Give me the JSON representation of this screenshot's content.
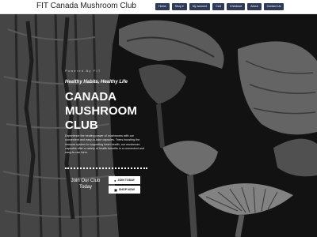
{
  "site": {
    "brand": "FIT Canada Mushroom Club"
  },
  "nav": {
    "items": [
      "Home",
      "Shop ▾",
      "My account",
      "Cart",
      "Checkout",
      "About",
      "Contact Us"
    ]
  },
  "hero": {
    "powered": "Powered By FIT",
    "tagline": "Healthy Habits, Healthy Life",
    "title": "CANADA MUSHROOM CLUB",
    "description": "Experience the healing power of mushrooms with our convenient and easy-to-take capsules. Trees boosting the immune system to supporting heart health, our mushroom capsules offer a variety of health benefits in a convenient and easy-to-use form.",
    "join_text": "Join Our Club Today",
    "join_button": "JOIN TODAY",
    "shop_button": "SHOP NOW"
  },
  "colors": {
    "nav_bg": "#2f3a56",
    "hero_bg": "#1a1a1a",
    "accent": "#ffffff"
  }
}
